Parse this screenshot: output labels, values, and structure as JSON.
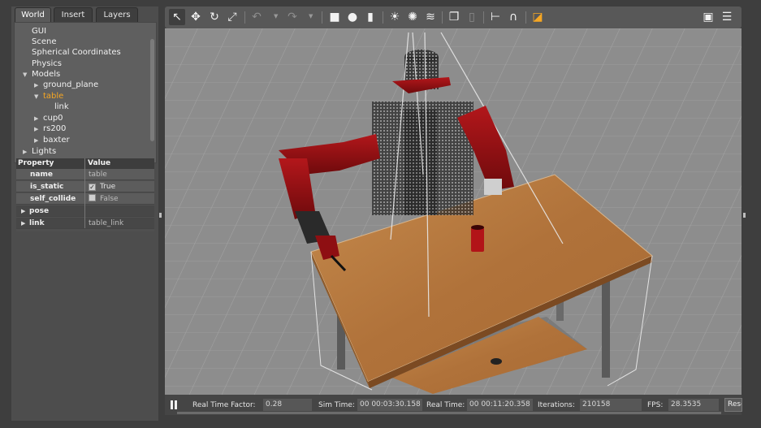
{
  "tabs": [
    {
      "label": "World",
      "active": true
    },
    {
      "label": "Insert",
      "active": false
    },
    {
      "label": "Layers",
      "active": false
    }
  ],
  "tree": {
    "items": [
      {
        "label": "GUI",
        "expander": ""
      },
      {
        "label": "Scene",
        "expander": ""
      },
      {
        "label": "Spherical Coordinates",
        "expander": ""
      },
      {
        "label": "Physics",
        "expander": ""
      },
      {
        "label": "Models",
        "expander": "▼"
      },
      {
        "label": "ground_plane",
        "expander": "▶"
      },
      {
        "label": "table",
        "expander": "▼",
        "selected": true
      },
      {
        "label": "link",
        "expander": ""
      },
      {
        "label": "cup0",
        "expander": "▶"
      },
      {
        "label": "rs200",
        "expander": "▶"
      },
      {
        "label": "baxter",
        "expander": "▶"
      },
      {
        "label": "Lights",
        "expander": "▶"
      }
    ]
  },
  "properties": {
    "header_property": "Property",
    "header_value": "Value",
    "rows": [
      {
        "key": "name",
        "value": "table"
      },
      {
        "key": "is_static",
        "value": "True",
        "checked": true
      },
      {
        "key": "self_collide",
        "value": "False",
        "checked": false
      },
      {
        "key": "pose",
        "value": "",
        "collapsed": true
      },
      {
        "key": "link",
        "value": "table_link",
        "collapsed": true
      }
    ]
  },
  "toolbar": {
    "tools": [
      {
        "name": "select-mode",
        "glyph": "↖",
        "active": true
      },
      {
        "name": "translate-mode",
        "glyph": "✥"
      },
      {
        "name": "rotate-mode",
        "glyph": "↻"
      },
      {
        "name": "scale-mode",
        "glyph": "⤢"
      },
      {
        "name": "undo",
        "glyph": "↶",
        "disabled": true
      },
      {
        "name": "redo",
        "glyph": "↷",
        "disabled": true
      },
      {
        "name": "box-shape",
        "glyph": "■"
      },
      {
        "name": "sphere-shape",
        "glyph": "●"
      },
      {
        "name": "cylinder-shape",
        "glyph": "▮"
      },
      {
        "name": "point-light",
        "glyph": "☀"
      },
      {
        "name": "spot-light",
        "glyph": "✺"
      },
      {
        "name": "directional-light",
        "glyph": "≋"
      },
      {
        "name": "copy",
        "glyph": "❐"
      },
      {
        "name": "paste",
        "glyph": "▯",
        "disabled": true
      },
      {
        "name": "align",
        "glyph": "⊢"
      },
      {
        "name": "magnet",
        "glyph": "∩"
      },
      {
        "name": "change-view",
        "glyph": "◪",
        "orange": true
      },
      {
        "name": "screenshot",
        "glyph": "▣"
      },
      {
        "name": "log",
        "glyph": "☰"
      }
    ]
  },
  "status": {
    "real_time_factor_label": "Real Time Factor:",
    "real_time_factor": "0.28",
    "sim_time_label": "Sim Time:",
    "sim_time": "00 00:03:30.158",
    "real_time_label": "Real Time:",
    "real_time": "00 00:11:20.358",
    "iterations_label": "Iterations:",
    "iterations": "210158",
    "fps_label": "FPS:",
    "fps": "28.3535",
    "reset_label": "Reset"
  },
  "colors": {
    "selected": "#f5a623",
    "robot_red": "#8e0f12",
    "table_wood": "#b7743c",
    "ground": "#8c8c8c"
  }
}
